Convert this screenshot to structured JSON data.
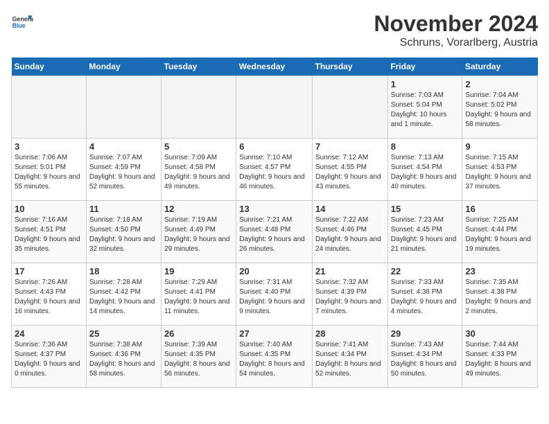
{
  "logo": {
    "general": "General",
    "blue": "Blue"
  },
  "title": "November 2024",
  "location": "Schruns, Vorarlberg, Austria",
  "days_of_week": [
    "Sunday",
    "Monday",
    "Tuesday",
    "Wednesday",
    "Thursday",
    "Friday",
    "Saturday"
  ],
  "weeks": [
    [
      {
        "day": "",
        "info": ""
      },
      {
        "day": "",
        "info": ""
      },
      {
        "day": "",
        "info": ""
      },
      {
        "day": "",
        "info": ""
      },
      {
        "day": "",
        "info": ""
      },
      {
        "day": "1",
        "info": "Sunrise: 7:03 AM\nSunset: 5:04 PM\nDaylight: 10 hours and 1 minute."
      },
      {
        "day": "2",
        "info": "Sunrise: 7:04 AM\nSunset: 5:02 PM\nDaylight: 9 hours and 58 minutes."
      }
    ],
    [
      {
        "day": "3",
        "info": "Sunrise: 7:06 AM\nSunset: 5:01 PM\nDaylight: 9 hours and 55 minutes."
      },
      {
        "day": "4",
        "info": "Sunrise: 7:07 AM\nSunset: 4:59 PM\nDaylight: 9 hours and 52 minutes."
      },
      {
        "day": "5",
        "info": "Sunrise: 7:09 AM\nSunset: 4:58 PM\nDaylight: 9 hours and 49 minutes."
      },
      {
        "day": "6",
        "info": "Sunrise: 7:10 AM\nSunset: 4:57 PM\nDaylight: 9 hours and 46 minutes."
      },
      {
        "day": "7",
        "info": "Sunrise: 7:12 AM\nSunset: 4:55 PM\nDaylight: 9 hours and 43 minutes."
      },
      {
        "day": "8",
        "info": "Sunrise: 7:13 AM\nSunset: 4:54 PM\nDaylight: 9 hours and 40 minutes."
      },
      {
        "day": "9",
        "info": "Sunrise: 7:15 AM\nSunset: 4:53 PM\nDaylight: 9 hours and 37 minutes."
      }
    ],
    [
      {
        "day": "10",
        "info": "Sunrise: 7:16 AM\nSunset: 4:51 PM\nDaylight: 9 hours and 35 minutes."
      },
      {
        "day": "11",
        "info": "Sunrise: 7:18 AM\nSunset: 4:50 PM\nDaylight: 9 hours and 32 minutes."
      },
      {
        "day": "12",
        "info": "Sunrise: 7:19 AM\nSunset: 4:49 PM\nDaylight: 9 hours and 29 minutes."
      },
      {
        "day": "13",
        "info": "Sunrise: 7:21 AM\nSunset: 4:48 PM\nDaylight: 9 hours and 26 minutes."
      },
      {
        "day": "14",
        "info": "Sunrise: 7:22 AM\nSunset: 4:46 PM\nDaylight: 9 hours and 24 minutes."
      },
      {
        "day": "15",
        "info": "Sunrise: 7:23 AM\nSunset: 4:45 PM\nDaylight: 9 hours and 21 minutes."
      },
      {
        "day": "16",
        "info": "Sunrise: 7:25 AM\nSunset: 4:44 PM\nDaylight: 9 hours and 19 minutes."
      }
    ],
    [
      {
        "day": "17",
        "info": "Sunrise: 7:26 AM\nSunset: 4:43 PM\nDaylight: 9 hours and 16 minutes."
      },
      {
        "day": "18",
        "info": "Sunrise: 7:28 AM\nSunset: 4:42 PM\nDaylight: 9 hours and 14 minutes."
      },
      {
        "day": "19",
        "info": "Sunrise: 7:29 AM\nSunset: 4:41 PM\nDaylight: 9 hours and 11 minutes."
      },
      {
        "day": "20",
        "info": "Sunrise: 7:31 AM\nSunset: 4:40 PM\nDaylight: 9 hours and 9 minutes."
      },
      {
        "day": "21",
        "info": "Sunrise: 7:32 AM\nSunset: 4:39 PM\nDaylight: 9 hours and 7 minutes."
      },
      {
        "day": "22",
        "info": "Sunrise: 7:33 AM\nSunset: 4:38 PM\nDaylight: 9 hours and 4 minutes."
      },
      {
        "day": "23",
        "info": "Sunrise: 7:35 AM\nSunset: 4:38 PM\nDaylight: 9 hours and 2 minutes."
      }
    ],
    [
      {
        "day": "24",
        "info": "Sunrise: 7:36 AM\nSunset: 4:37 PM\nDaylight: 9 hours and 0 minutes."
      },
      {
        "day": "25",
        "info": "Sunrise: 7:38 AM\nSunset: 4:36 PM\nDaylight: 8 hours and 58 minutes."
      },
      {
        "day": "26",
        "info": "Sunrise: 7:39 AM\nSunset: 4:35 PM\nDaylight: 8 hours and 56 minutes."
      },
      {
        "day": "27",
        "info": "Sunrise: 7:40 AM\nSunset: 4:35 PM\nDaylight: 8 hours and 54 minutes."
      },
      {
        "day": "28",
        "info": "Sunrise: 7:41 AM\nSunset: 4:34 PM\nDaylight: 8 hours and 52 minutes."
      },
      {
        "day": "29",
        "info": "Sunrise: 7:43 AM\nSunset: 4:34 PM\nDaylight: 8 hours and 50 minutes."
      },
      {
        "day": "30",
        "info": "Sunrise: 7:44 AM\nSunset: 4:33 PM\nDaylight: 8 hours and 49 minutes."
      }
    ]
  ]
}
